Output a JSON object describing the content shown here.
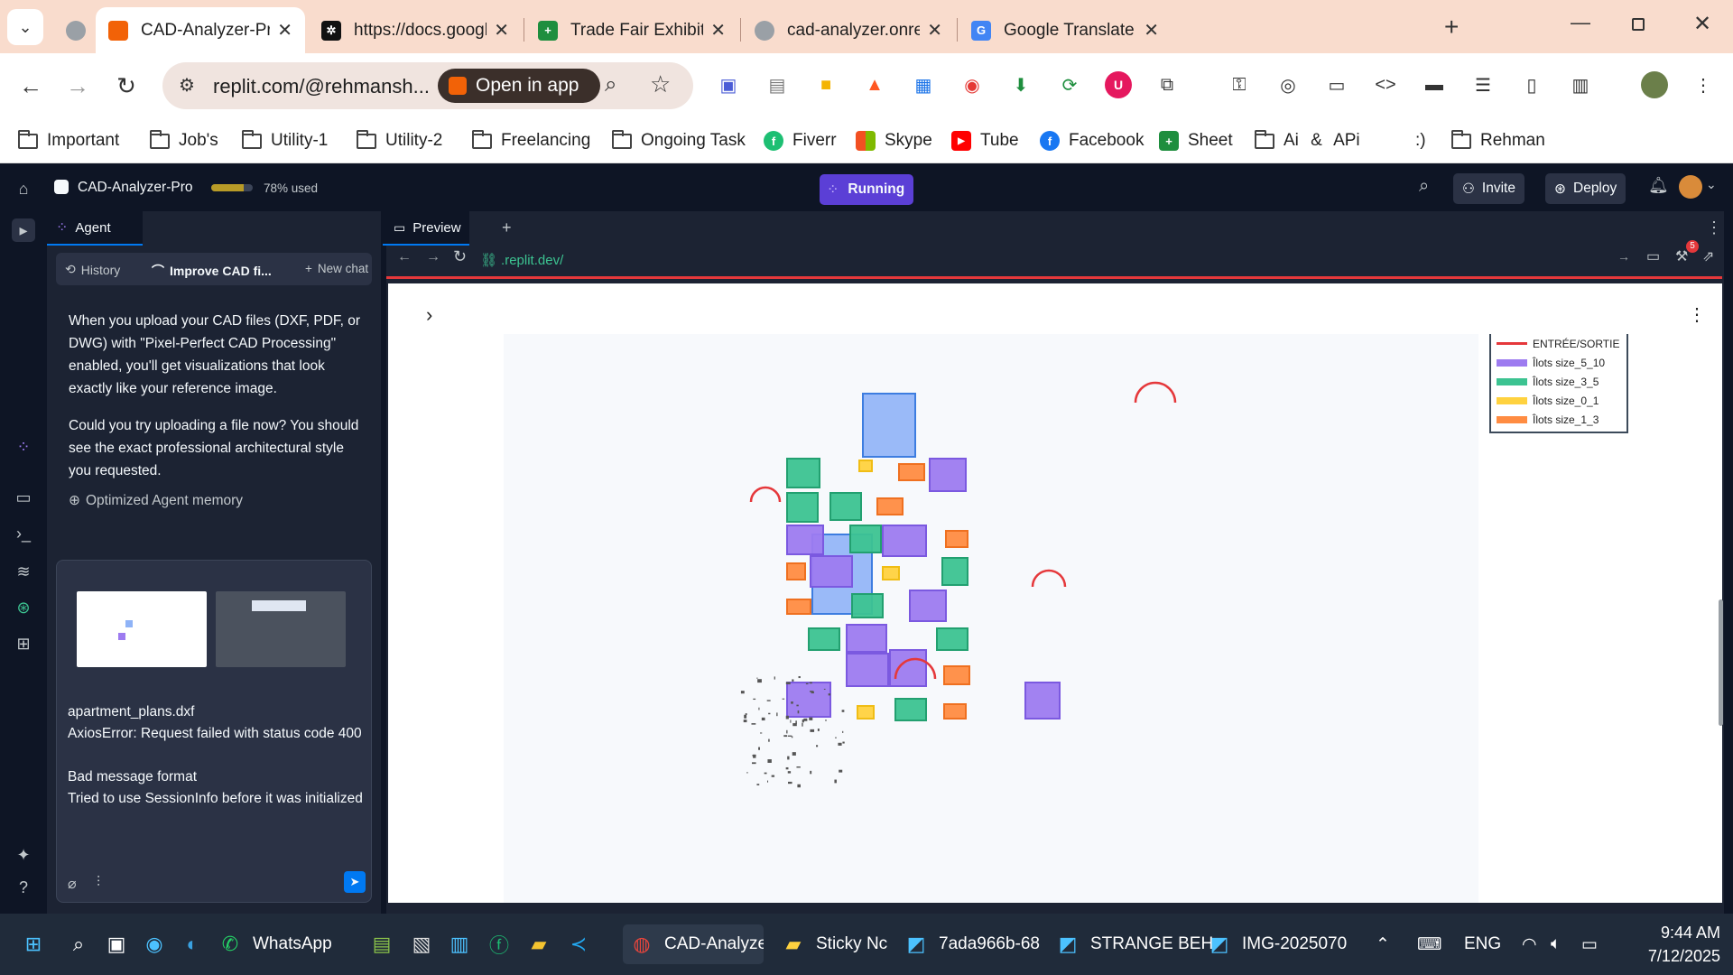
{
  "browser": {
    "tabs": [
      {
        "title": "",
        "active": false
      },
      {
        "title": "CAD-Analyzer-Pro - Replit",
        "active": true
      },
      {
        "title": "https://docs.google.com",
        "active": false
      },
      {
        "title": "Trade Fair Exhibitor Data",
        "active": false
      },
      {
        "title": "cad-analyzer.onrender.com",
        "active": false
      },
      {
        "title": "Google Translate",
        "active": false
      }
    ],
    "new_tab": "+",
    "address": "replit.com/@rehmansh...",
    "open_in_app": "Open in app",
    "bookmarks": [
      "Important",
      "Job's",
      "Utility-1",
      "Utility-2",
      "Freelancing",
      "Ongoing Task",
      "Fiverr",
      "Skype",
      "Tube",
      "Facebook",
      "Sheet",
      "Ai & APi",
      ":)",
      "Rehman"
    ]
  },
  "replit": {
    "project_name": "CAD-Analyzer-Pro",
    "usage": "78% used",
    "usage_fraction": 0.78,
    "run_status": "Running",
    "invite": "Invite",
    "deploy": "Deploy",
    "agent_tab": "Agent",
    "history": "History",
    "chat_title": "Improve CAD fi...",
    "new_chat": "New chat",
    "messages": [
      "When you upload your CAD files (DXF, PDF, or DWG) with \"Pixel-Perfect CAD Processing\" enabled, you'll get visualizations that look exactly like your reference image.",
      "Could you try uploading a file now? You should see the exact professional architectural style you requested."
    ],
    "memory_note": "Optimized Agent memory",
    "input_text": [
      "apartment_plans.dxf",
      "AxiosError: Request failed with status code 400",
      "",
      "Bad message format",
      "Tried to use SessionInfo before it was initialized"
    ],
    "preview_tab": "Preview",
    "preview_url": ".replit.dev/",
    "notif_count": "5"
  },
  "legend": {
    "items": [
      {
        "label": "ENTRÉE/SORTIE",
        "color": "#e5383b",
        "kind": "line"
      },
      {
        "label": "Îlots size_5_10",
        "color": "#9d7bf0",
        "kind": "bar"
      },
      {
        "label": "Îlots size_3_5",
        "color": "#3cc391",
        "kind": "bar"
      },
      {
        "label": "Îlots size_0_1",
        "color": "#ffd23f",
        "kind": "bar"
      },
      {
        "label": "Îlots size_1_3",
        "color": "#ff8c42",
        "kind": "bar"
      }
    ]
  },
  "taskbar": {
    "items": [
      "WhatsApp",
      "CAD-Analyzer",
      "Sticky Nc",
      "7ada966b-68",
      "STRANGE BEH",
      "IMG-2025070"
    ],
    "lang": "ENG",
    "time": "9:44 AM",
    "date": "7/12/2025"
  }
}
